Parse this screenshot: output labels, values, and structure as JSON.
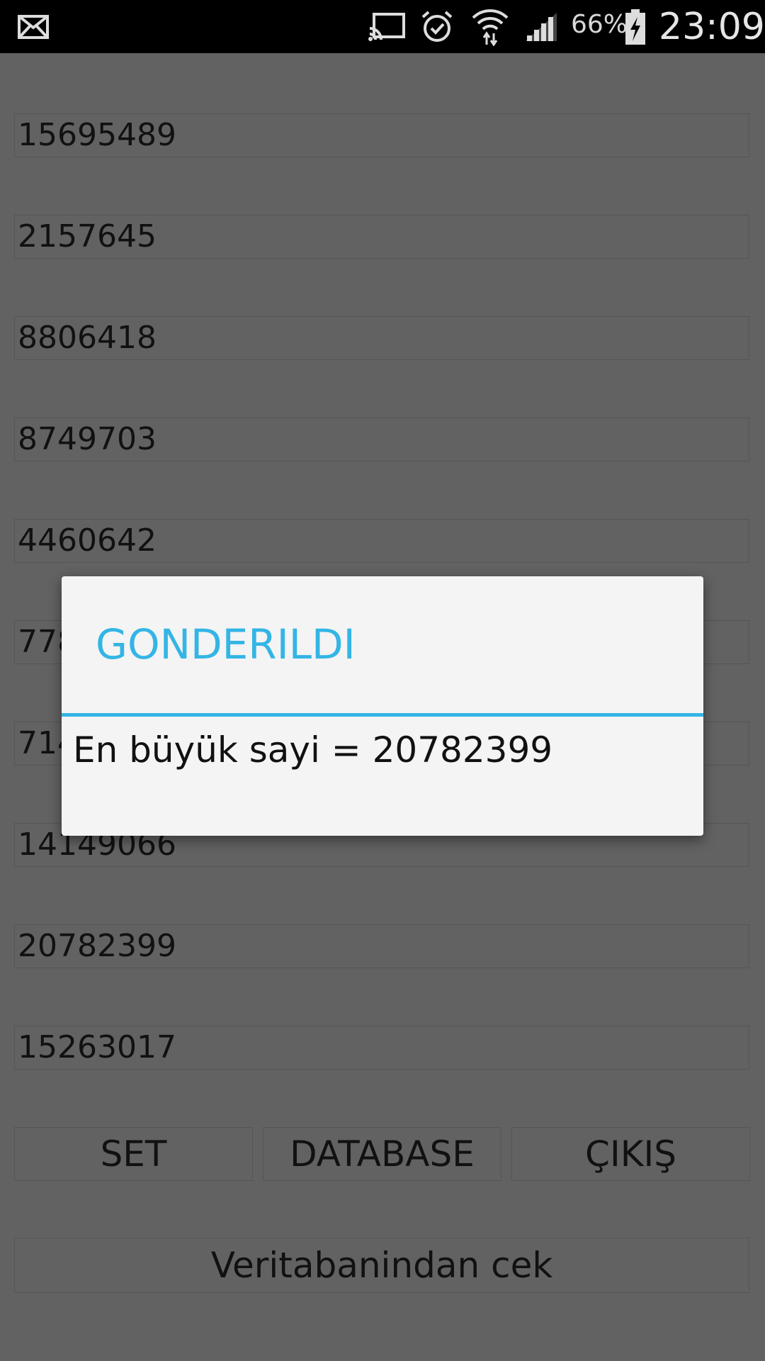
{
  "status_bar": {
    "battery_percent": "66%",
    "time": "23:09",
    "icons": [
      "mail-icon",
      "cast-icon",
      "alarm-icon",
      "wifi-icon",
      "signal-icon",
      "battery-charging-icon"
    ]
  },
  "fields": [
    {
      "value": "15695489"
    },
    {
      "value": "2157645"
    },
    {
      "value": "8806418"
    },
    {
      "value": "8749703"
    },
    {
      "value": "4460642"
    },
    {
      "value": "778"
    },
    {
      "value": "714"
    },
    {
      "value": "14149066"
    },
    {
      "value": "20782399"
    },
    {
      "value": "15263017"
    }
  ],
  "buttons": {
    "set_label": "SET",
    "database_label": "DATABASE",
    "exit_label": "ÇIKIŞ",
    "fetch_label": "Veritabanindan cek"
  },
  "dialog": {
    "title": "GONDERILDI",
    "message": "En büyük sayi = 20782399",
    "accent_color": "#33b5e5"
  }
}
